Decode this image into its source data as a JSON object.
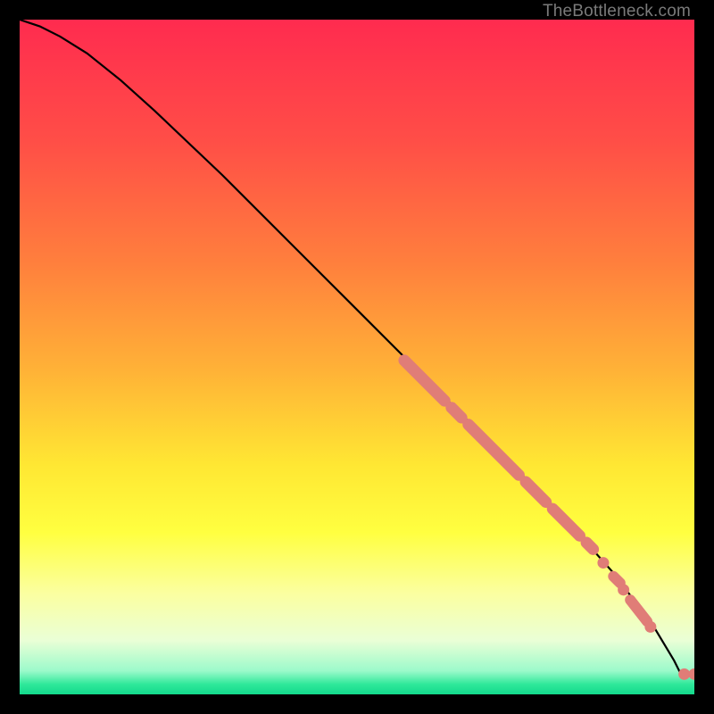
{
  "attribution": "TheBottleneck.com",
  "colors": {
    "line": "#000000",
    "marker": "#e07d77",
    "gradient_stops": [
      {
        "offset": 0.0,
        "color": "#ff2b4f"
      },
      {
        "offset": 0.18,
        "color": "#ff4e47"
      },
      {
        "offset": 0.36,
        "color": "#ff7f3d"
      },
      {
        "offset": 0.52,
        "color": "#ffb237"
      },
      {
        "offset": 0.66,
        "color": "#ffe733"
      },
      {
        "offset": 0.76,
        "color": "#ffff40"
      },
      {
        "offset": 0.85,
        "color": "#fbffa0"
      },
      {
        "offset": 0.92,
        "color": "#eaffd6"
      },
      {
        "offset": 0.965,
        "color": "#9cfacb"
      },
      {
        "offset": 0.985,
        "color": "#2fe89a"
      },
      {
        "offset": 1.0,
        "color": "#13d98c"
      }
    ]
  },
  "chart_data": {
    "type": "line",
    "title": "",
    "xlabel": "",
    "ylabel": "",
    "xlim": [
      0,
      100
    ],
    "ylim": [
      0,
      100
    ],
    "series": [
      {
        "name": "curve",
        "x": [
          0,
          3,
          6,
          10,
          15,
          20,
          30,
          40,
          50,
          60,
          70,
          80,
          88,
          94,
          97,
          98,
          100
        ],
        "y": [
          100,
          99,
          97.5,
          95,
          91,
          86.5,
          77,
          67,
          57,
          47,
          37,
          27,
          18,
          10,
          5,
          3,
          3
        ]
      }
    ],
    "markers": {
      "name": "highlighted-points",
      "segments": [
        {
          "x0": 57,
          "y0": 49.5,
          "x1": 63,
          "y1": 43.5
        },
        {
          "x0": 64,
          "y0": 42.5,
          "x1": 65.5,
          "y1": 41
        },
        {
          "x0": 66.5,
          "y0": 40,
          "x1": 74,
          "y1": 32.5
        },
        {
          "x0": 75,
          "y0": 31.5,
          "x1": 78,
          "y1": 28.5
        },
        {
          "x0": 79,
          "y0": 27.5,
          "x1": 83,
          "y1": 23.5
        },
        {
          "x0": 84,
          "y0": 22.5,
          "x1": 85,
          "y1": 21.5
        }
      ],
      "dots": [
        {
          "x": 86.5,
          "y": 19.5
        },
        {
          "x": 89.5,
          "y": 15.5
        },
        {
          "x": 93.5,
          "y": 10
        },
        {
          "x": 98.5,
          "y": 3
        },
        {
          "x": 100,
          "y": 3
        }
      ],
      "short_segments": [
        {
          "x0": 88,
          "y0": 17.5,
          "x1": 89,
          "y1": 16.5
        },
        {
          "x0": 90.5,
          "y0": 14,
          "x1": 93,
          "y1": 10.8
        }
      ]
    }
  }
}
